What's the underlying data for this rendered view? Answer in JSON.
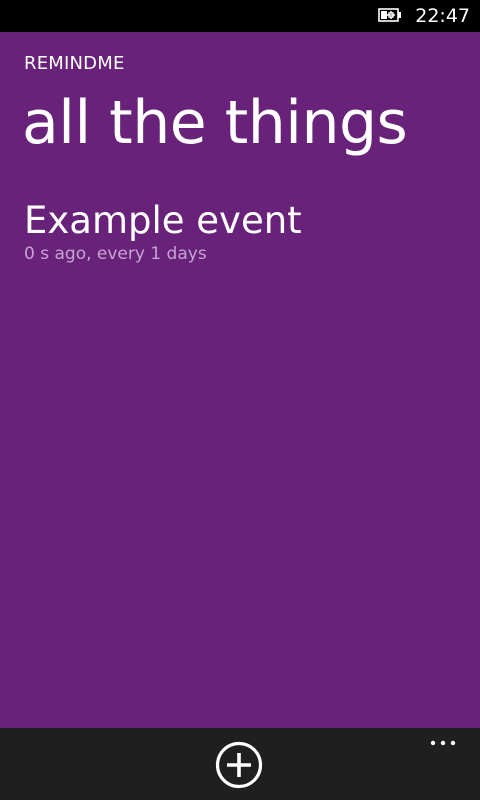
{
  "status_bar": {
    "time": "22:47",
    "battery_icon": "battery-charging-icon"
  },
  "app": {
    "name": "REMINDME",
    "page_title": "all the things",
    "accent_color": "#68227a",
    "app_bar_color": "#1f1f1f",
    "subtle_text_color": "#c7a4d3"
  },
  "events": [
    {
      "title": "Example event",
      "subtitle": "0 s ago, every 1 days"
    }
  ],
  "app_bar": {
    "add_icon": "add-circle-icon",
    "more_icon": "more-ellipsis-icon"
  }
}
